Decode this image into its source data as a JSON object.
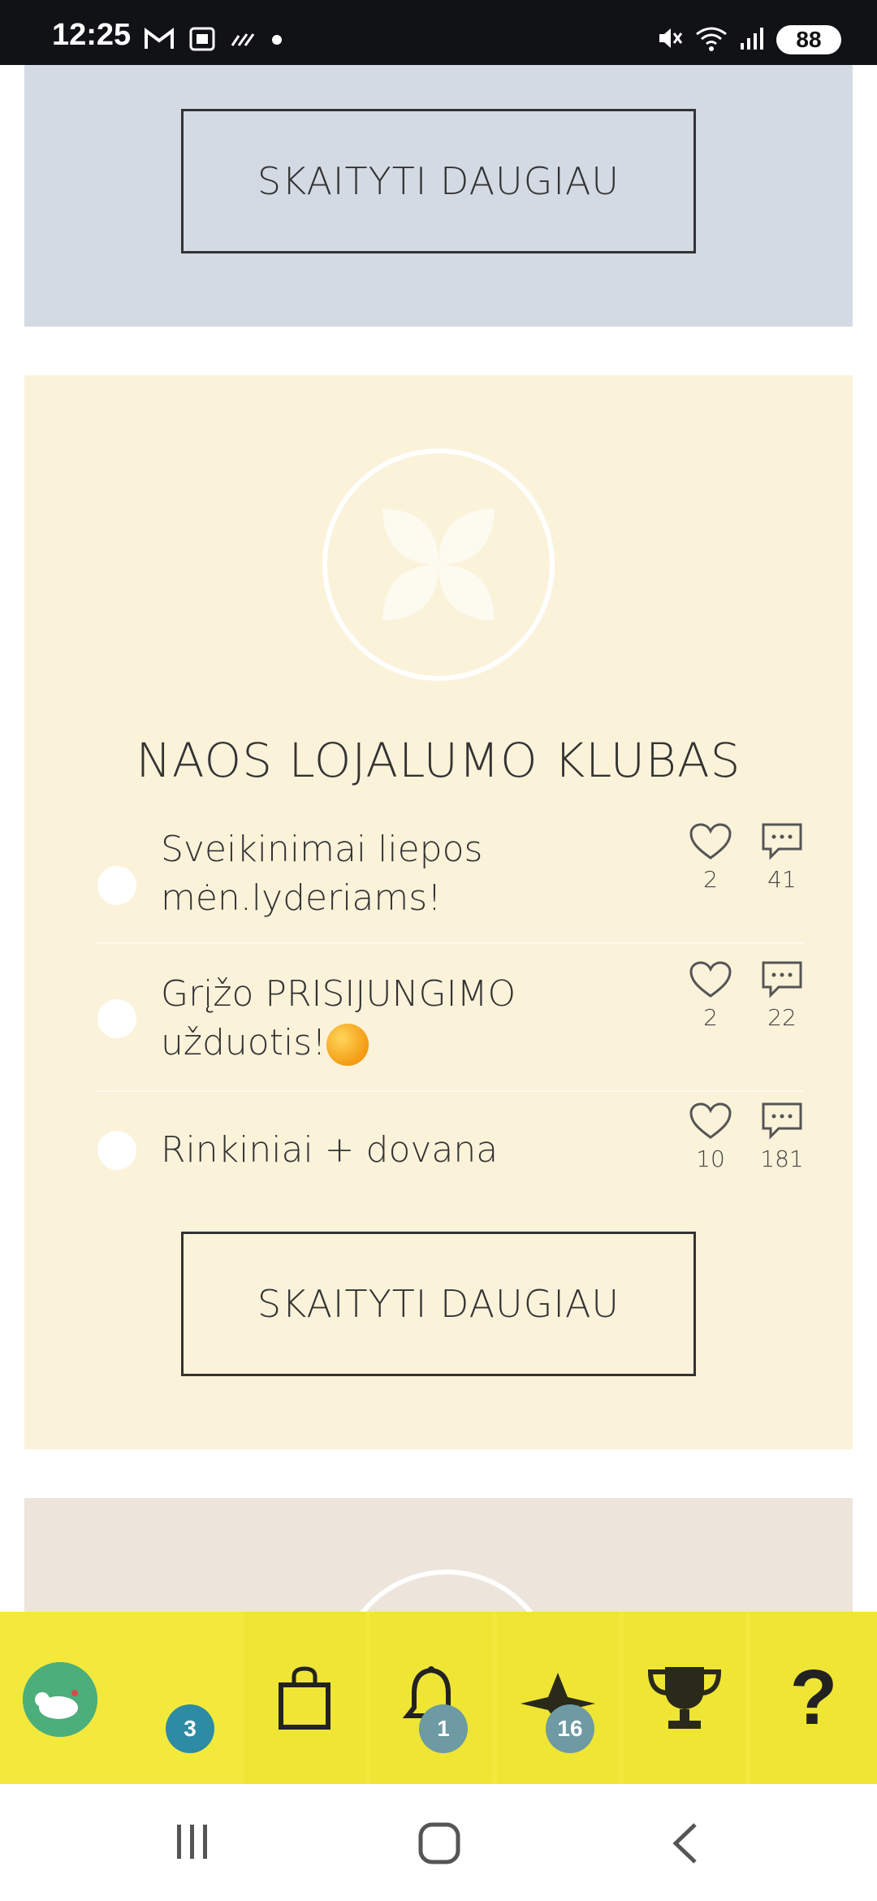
{
  "status_bar": {
    "time": "12:25",
    "battery": "88"
  },
  "cards": {
    "top": {
      "read_more_label": "SKAITYTI DAUGIAU"
    },
    "club": {
      "title": "NAOS LOJALUMO KLUBAS",
      "posts": [
        {
          "title_line1": "Sveikinimai liepos",
          "title_line2": "mėn.lyderiams!",
          "likes": "2",
          "comments": "41"
        },
        {
          "title_line1": "Grįžo PRISIJUNGIMO",
          "title_line2": "užduotis!",
          "likes": "2",
          "comments": "22"
        },
        {
          "title_line1": "Rinkiniai + dovana",
          "title_line2": "",
          "likes": "10",
          "comments": "181"
        }
      ],
      "read_more_label": "SKAITYTI DAUGIAU"
    }
  },
  "bottom_nav": {
    "profile_badge": "3",
    "notifications_badge": "1",
    "points_badge": "16",
    "help_label": "?"
  },
  "icons": {
    "status_left": [
      "gmail-icon",
      "screenshot-icon",
      "signal-dots-icon"
    ],
    "status_right": [
      "mute-icon",
      "wifi-icon",
      "cellular-icon"
    ],
    "nav": [
      "shopping-bag-icon",
      "bell-icon",
      "star-hat-icon",
      "trophy-icon",
      "help-icon"
    ],
    "android": [
      "recents-icon",
      "home-icon",
      "back-icon"
    ]
  },
  "colors": {
    "blue_card": "#d3dae3",
    "cream_card": "#fbf2da",
    "beige_card": "#ede4dc",
    "nav_yellow": "#f3e93c",
    "badge_teal": "#2d8ba3",
    "badge_grey": "#6d9aa3"
  }
}
